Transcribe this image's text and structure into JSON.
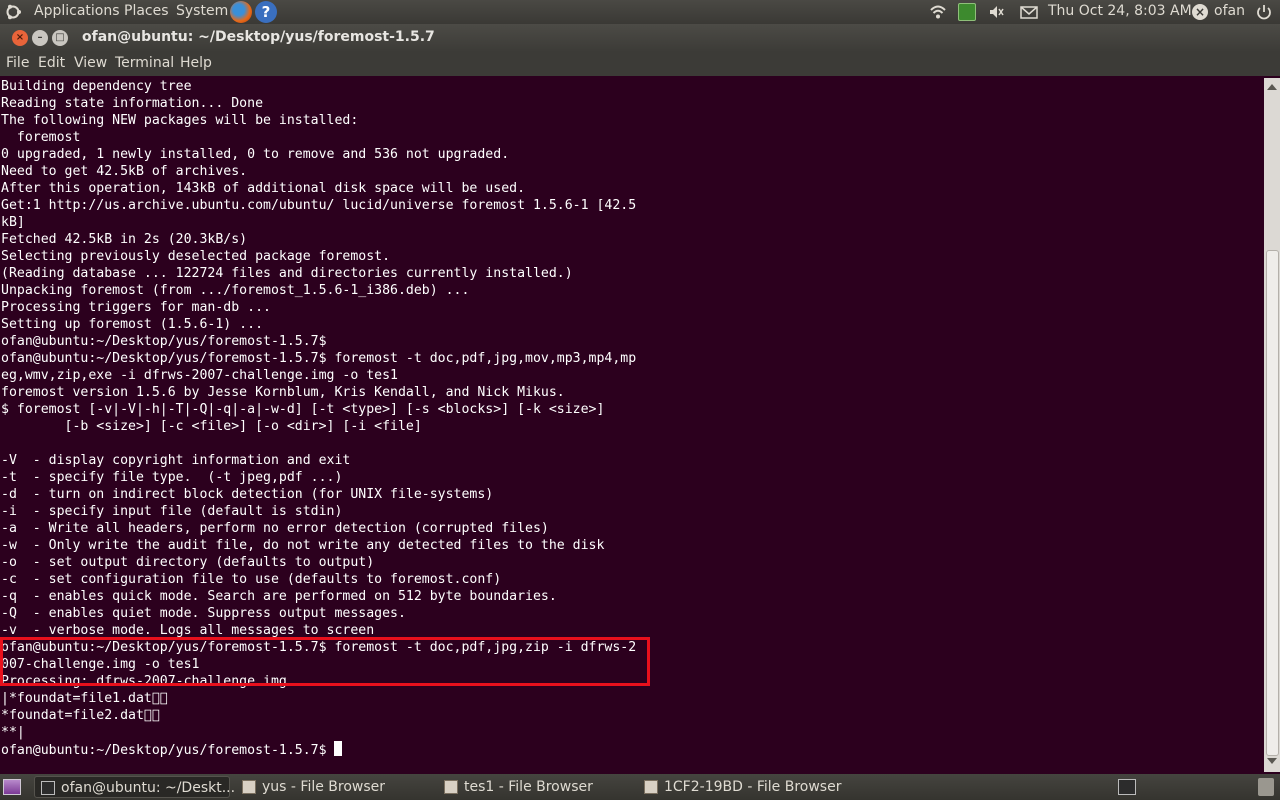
{
  "top_panel": {
    "menus": [
      "Applications",
      "Places",
      "System"
    ],
    "clock": "Thu Oct 24,  8:03 AM",
    "user": "ofan"
  },
  "window": {
    "title": "ofan@ubuntu: ~/Desktop/yus/foremost-1.5.7",
    "menu": [
      "File",
      "Edit",
      "View",
      "Terminal",
      "Help"
    ]
  },
  "terminal": {
    "lines": [
      "Building dependency tree",
      "Reading state information... Done",
      "The following NEW packages will be installed:",
      "  foremost",
      "0 upgraded, 1 newly installed, 0 to remove and 536 not upgraded.",
      "Need to get 42.5kB of archives.",
      "After this operation, 143kB of additional disk space will be used.",
      "Get:1 http://us.archive.ubuntu.com/ubuntu/ lucid/universe foremost 1.5.6-1 [42.5",
      "kB]",
      "Fetched 42.5kB in 2s (20.3kB/s)",
      "Selecting previously deselected package foremost.",
      "(Reading database ... 122724 files and directories currently installed.)",
      "Unpacking foremost (from .../foremost_1.5.6-1_i386.deb) ...",
      "Processing triggers for man-db ...",
      "Setting up foremost (1.5.6-1) ...",
      "ofan@ubuntu:~/Desktop/yus/foremost-1.5.7$",
      "ofan@ubuntu:~/Desktop/yus/foremost-1.5.7$ foremost -t doc,pdf,jpg,mov,mp3,mp4,mp",
      "eg,wmv,zip,exe -i dfrws-2007-challenge.img -o tes1",
      "foremost version 1.5.6 by Jesse Kornblum, Kris Kendall, and Nick Mikus.",
      "$ foremost [-v|-V|-h|-T|-Q|-q|-a|-w-d] [-t <type>] [-s <blocks>] [-k <size>]",
      "        [-b <size>] [-c <file>] [-o <dir>] [-i <file]",
      "",
      "-V  - display copyright information and exit",
      "-t  - specify file type.  (-t jpeg,pdf ...)",
      "-d  - turn on indirect block detection (for UNIX file-systems)",
      "-i  - specify input file (default is stdin)",
      "-a  - Write all headers, perform no error detection (corrupted files)",
      "-w  - Only write the audit file, do not write any detected files to the disk",
      "-o  - set output directory (defaults to output)",
      "-c  - set configuration file to use (defaults to foremost.conf)",
      "-q  - enables quick mode. Search are performed on 512 byte boundaries.",
      "-Q  - enables quiet mode. Suppress output messages.",
      "-v  - verbose mode. Logs all messages to screen",
      "ofan@ubuntu:~/Desktop/yus/foremost-1.5.7$ foremost -t doc,pdf,jpg,zip -i dfrws-2",
      "007-challenge.img -o tes1",
      "Processing: dfrws-2007-challenge.img",
      "|*foundat=file1.dat\u0000\u0000",
      "*foundat=file2.dat\u0000\u0000",
      "**|"
    ],
    "prompt": "ofan@ubuntu:~/Desktop/yus/foremost-1.5.7$ "
  },
  "taskbar": {
    "tasks": [
      "ofan@ubuntu: ~/Deskt...",
      "yus - File Browser",
      "tes1 - File Browser",
      "1CF2-19BD - File Browser"
    ]
  },
  "colors": {
    "terminal_bg": "#2c001e",
    "terminal_fg": "#ffffff",
    "highlight": "#e8101c",
    "panel": "#3c3b37"
  }
}
